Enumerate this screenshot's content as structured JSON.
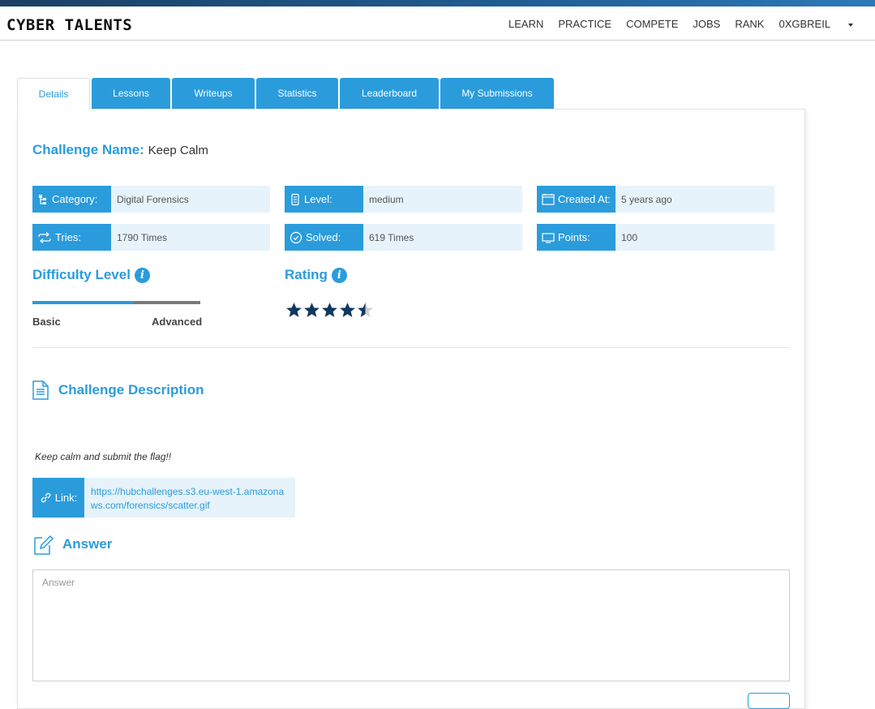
{
  "brand": {
    "logo": "CYBER TALENTS"
  },
  "nav": {
    "items": [
      "LEARN",
      "PRACTICE",
      "COMPETE",
      "JOBS",
      "RANK"
    ],
    "user": "0XGBREIL"
  },
  "tabs": [
    "Details",
    "Lessons",
    "Writeups",
    "Statistics",
    "Leaderboard",
    "My Submissions"
  ],
  "challenge": {
    "name_label": "Challenge Name:",
    "name": "Keep Calm"
  },
  "info": {
    "category": {
      "label": "Category:",
      "value": "Digital Forensics"
    },
    "level": {
      "label": "Level:",
      "value": "medium"
    },
    "created": {
      "label": "Created At:",
      "value": "5 years ago"
    },
    "tries": {
      "label": "Tries:",
      "value": "1790 Times"
    },
    "solved": {
      "label": "Solved:",
      "value": "619 Times"
    },
    "points": {
      "label": "Points:",
      "value": "100"
    }
  },
  "difficulty": {
    "title": "Difficulty Level",
    "basic": "Basic",
    "advanced": "Advanced",
    "level_fraction": 0.6
  },
  "rating": {
    "title": "Rating",
    "stars": 4.5,
    "max": 5
  },
  "description": {
    "title": "Challenge Description",
    "text": "Keep calm and submit the flag!!"
  },
  "link": {
    "label": "Link:",
    "url": "https://hubchallenges.s3.eu-west-1.amazonaws.com/forensics/scatter.gif"
  },
  "answer": {
    "title": "Answer",
    "placeholder": "Answer"
  },
  "colors": {
    "accent": "#2a9cdc",
    "star": "#10385e",
    "light": "#e6f3fb"
  }
}
